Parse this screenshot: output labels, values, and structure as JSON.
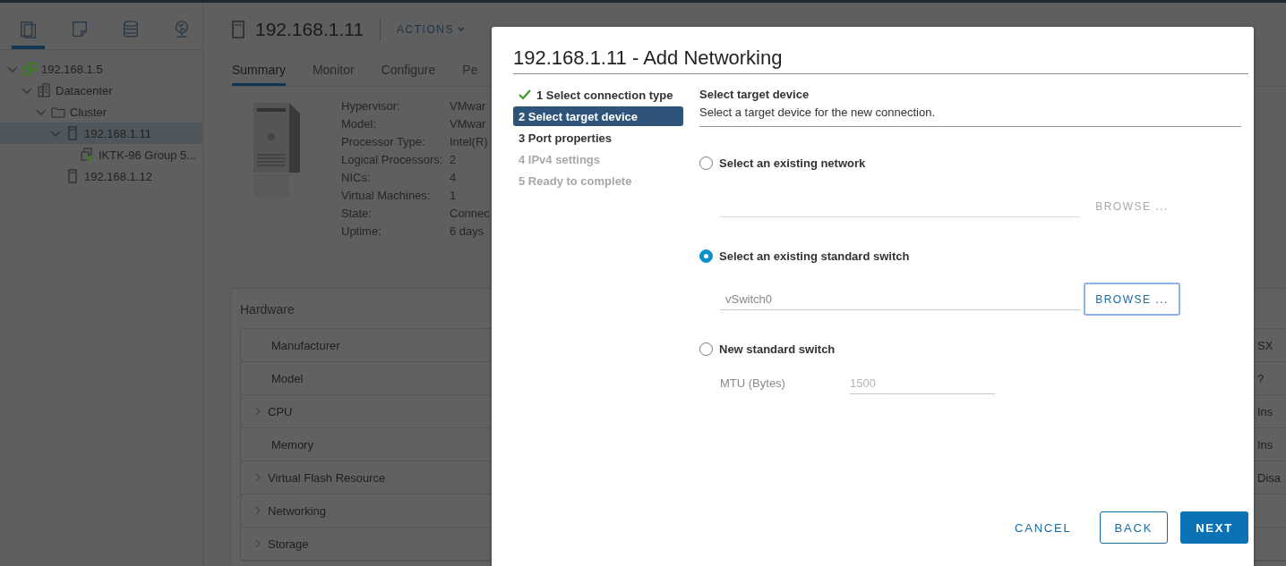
{
  "nav_tabs": [
    {
      "selected": true
    },
    {
      "selected": false
    },
    {
      "selected": false
    },
    {
      "selected": false
    }
  ],
  "tree": [
    {
      "label": "192.168.1.5",
      "kind": "vcenter",
      "expanded": true,
      "selected": false,
      "children": [
        {
          "label": "Datacenter",
          "kind": "datacenter",
          "expanded": true,
          "selected": false,
          "children": [
            {
              "label": "Cluster",
              "kind": "cluster",
              "expanded": true,
              "selected": false,
              "children": [
                {
                  "label": "192.168.1.11",
                  "kind": "host",
                  "expanded": true,
                  "selected": true,
                  "children": [
                    {
                      "label": "IKTK-96 Group 5...",
                      "kind": "vapp",
                      "selected": false
                    }
                  ]
                },
                {
                  "label": "192.168.1.12",
                  "kind": "host",
                  "selected": false
                }
              ]
            }
          ]
        }
      ]
    }
  ],
  "host": {
    "title": "192.168.1.11",
    "actions": "ACTIONS"
  },
  "tabs": [
    {
      "label": "Summary",
      "selected": true
    },
    {
      "label": "Monitor",
      "selected": false
    },
    {
      "label": "Configure",
      "selected": false
    },
    {
      "label": "Pe",
      "selected": false
    }
  ],
  "summary": [
    {
      "label": "Hypervisor:",
      "value": "VMwar"
    },
    {
      "label": "Model:",
      "value": "VMwar"
    },
    {
      "label": "Processor Type:",
      "value": "Intel(R)"
    },
    {
      "label": "Logical Processors:",
      "value": "2"
    },
    {
      "label": "NICs:",
      "value": "4"
    },
    {
      "label": "Virtual Machines:",
      "value": "1"
    },
    {
      "label": "State:",
      "value": "Connec"
    },
    {
      "label": "Uptime:",
      "value": "6 days"
    }
  ],
  "hardware": {
    "title": "Hardware",
    "rows": [
      {
        "label": "Manufacturer",
        "expandable": false,
        "value": "SX"
      },
      {
        "label": "Model",
        "expandable": false,
        "value": "?"
      },
      {
        "label": "CPU",
        "expandable": true,
        "value": "Ins"
      },
      {
        "label": "Memory",
        "expandable": false,
        "value": "Ins"
      },
      {
        "label": "Virtual Flash Resource",
        "expandable": true,
        "value": "Disa"
      },
      {
        "label": "Networking",
        "expandable": true
      },
      {
        "label": "Storage",
        "expandable": true
      }
    ]
  },
  "dialog": {
    "title": "192.168.1.11 - Add Networking",
    "steps": [
      {
        "label": "1 Select connection type",
        "done": true,
        "selected": false,
        "disabled": false
      },
      {
        "label": "2 Select target device",
        "done": false,
        "selected": true,
        "disabled": false
      },
      {
        "label": "3 Port properties",
        "done": false,
        "selected": false,
        "disabled": false
      },
      {
        "label": "4 IPv4 settings",
        "done": false,
        "selected": false,
        "disabled": true
      },
      {
        "label": "5 Ready to complete",
        "done": false,
        "selected": false,
        "disabled": true
      }
    ],
    "heading": "Select target device",
    "description": "Select a target device for the new connection.",
    "options": [
      {
        "label": "Select an existing network",
        "selected": false,
        "field": {
          "disabled": true
        },
        "browse": {
          "label": "BROWSE ...",
          "disabled": true
        }
      },
      {
        "label": "Select an existing standard switch",
        "selected": true,
        "field": {
          "value": "vSwitch0",
          "disabled": false
        },
        "browse": {
          "label": "BROWSE ...",
          "disabled": false
        }
      },
      {
        "label": "New standard switch",
        "selected": false,
        "mtu": {
          "label": "MTU (Bytes)",
          "value": "1500"
        }
      }
    ],
    "buttons": [
      {
        "label": "CANCEL",
        "kind": "flat"
      },
      {
        "label": "BACK",
        "kind": "outline"
      },
      {
        "label": "NEXT",
        "kind": "primary"
      }
    ]
  }
}
